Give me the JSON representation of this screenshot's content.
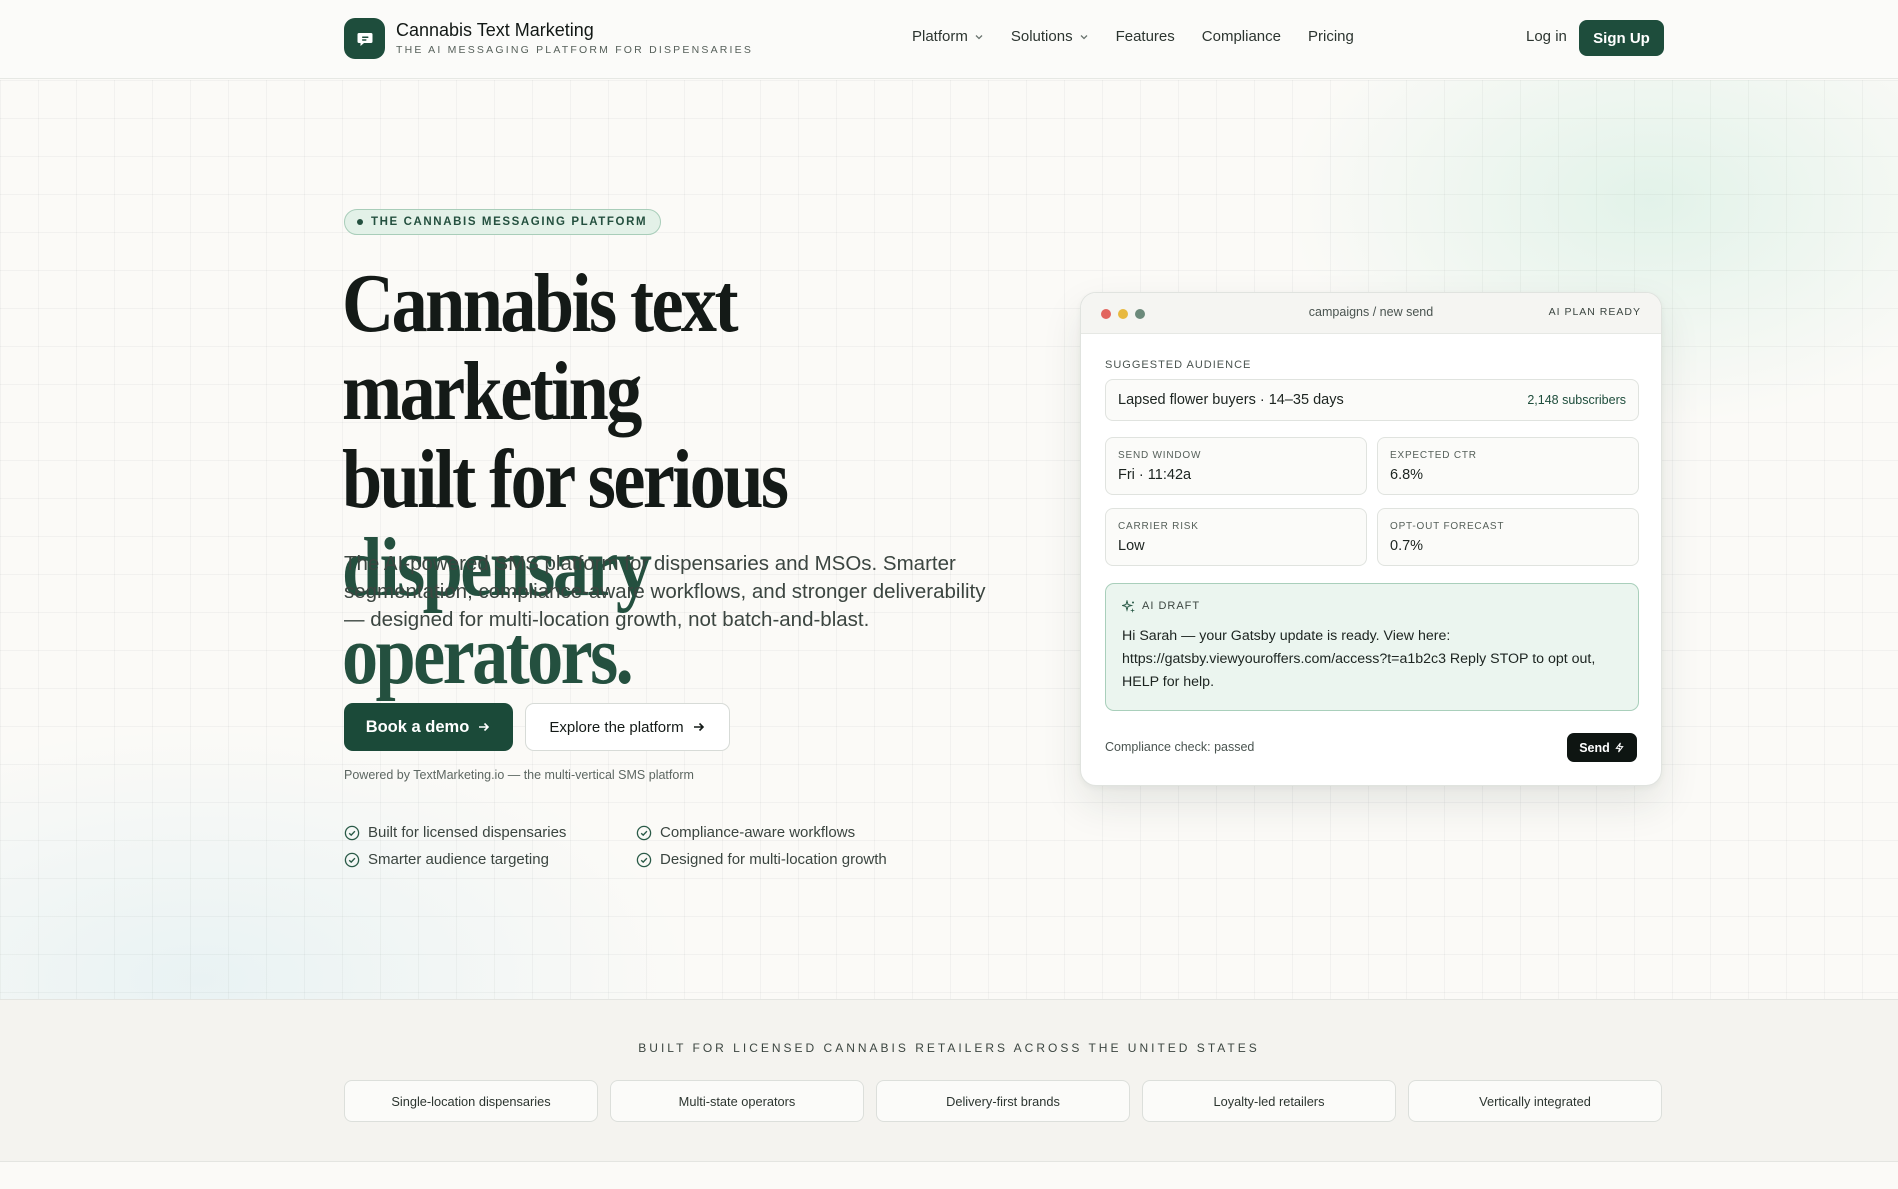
{
  "brand": {
    "name": "Cannabis Text Marketing",
    "tagline": "THE AI MESSAGING PLATFORM FOR DISPENSARIES",
    "logo_icon": "chat-bubble-icon",
    "color": "#1e4d3c"
  },
  "nav": {
    "links": [
      {
        "label": "Platform",
        "dropdown": true
      },
      {
        "label": "Solutions",
        "dropdown": true
      },
      {
        "label": "Features",
        "dropdown": false
      },
      {
        "label": "Compliance",
        "dropdown": false
      },
      {
        "label": "Pricing",
        "dropdown": false
      }
    ],
    "login": "Log in",
    "signup": "Sign Up"
  },
  "hero": {
    "badge": "THE CANNABIS MESSAGING PLATFORM",
    "headline_line1": "Cannabis text marketing",
    "headline_line2": "built for serious",
    "headline_accent": "dispensary operators.",
    "lead": "The AI-powered SMS platform for dispensaries and MSOs. Smarter segmentation, compliance-aware workflows, and stronger deliverability — designed for multi-location growth, not batch-and-blast.",
    "cta_primary": "Book a demo",
    "cta_secondary": "Explore the platform",
    "powered_by": "Powered by TextMarketing.io — the multi-vertical SMS platform",
    "checks": [
      "Built for licensed dispensaries",
      "Compliance-aware workflows",
      "Smarter audience targeting",
      "Designed for multi-location growth"
    ]
  },
  "card": {
    "path": "campaigns / new send",
    "status": "AI PLAN READY",
    "audience_label": "SUGGESTED AUDIENCE",
    "audience_name": "Lapsed flower buyers · 14–35 days",
    "audience_count": "2,148 subscribers",
    "stats": [
      {
        "label": "SEND WINDOW",
        "value": "Fri · 11:42a"
      },
      {
        "label": "EXPECTED CTR",
        "value": "6.8%"
      },
      {
        "label": "CARRIER RISK",
        "value": "Low"
      },
      {
        "label": "OPT-OUT FORECAST",
        "value": "0.7%"
      }
    ],
    "draft_label": "AI DRAFT",
    "draft_text": "Hi Sarah — your Gatsby update is ready. View here: https://gatsby.viewyouroffers.com/access?t=a1b2c3 Reply STOP to opt out, HELP for help.",
    "compliance": "Compliance check: passed",
    "send": "Send"
  },
  "strip": {
    "title": "BUILT FOR LICENSED CANNABIS RETAILERS ACROSS THE UNITED STATES",
    "tags": [
      "Single-location dispensaries",
      "Multi-state operators",
      "Delivery-first brands",
      "Loyalty-led retailers",
      "Vertically integrated"
    ]
  }
}
